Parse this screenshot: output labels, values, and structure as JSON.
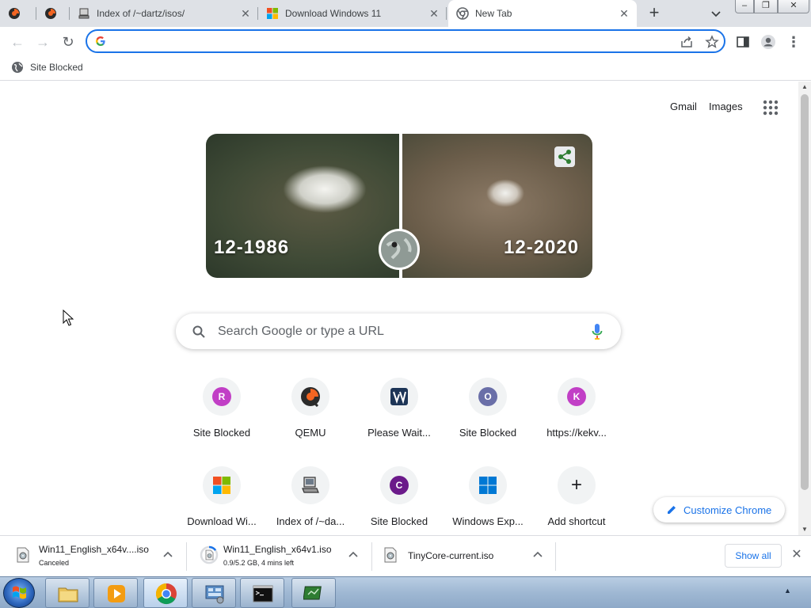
{
  "tabs": [
    {
      "title": "",
      "active": false
    },
    {
      "title": "",
      "active": false
    },
    {
      "title": "Index of /~dartz/isos/",
      "active": false
    },
    {
      "title": "Download Windows 11",
      "active": false
    },
    {
      "title": "New Tab",
      "active": true
    }
  ],
  "window_controls": {
    "minimize": "–",
    "restore": "❐",
    "close": "✕"
  },
  "toolbar": {
    "back_icon": "←",
    "forward_icon": "→",
    "reload_icon": "↻",
    "omnibox_value": "",
    "menu_icon": "⋮"
  },
  "bookmarks": [
    {
      "label": "Site Blocked"
    }
  ],
  "ntp": {
    "gmail": "Gmail",
    "images": "Images",
    "doodle": {
      "date_left": "12-1986",
      "date_right": "12-2020"
    },
    "search_placeholder": "Search Google or type a URL",
    "shortcuts": [
      {
        "label": "Site Blocked",
        "letter": "R",
        "color": "#c13fc6"
      },
      {
        "label": "QEMU",
        "letter": "",
        "color": "#f26522"
      },
      {
        "label": "Please Wait...",
        "letter": "",
        "color": "#1d4f91"
      },
      {
        "label": "Site Blocked",
        "letter": "O",
        "color": "#6a6fa8"
      },
      {
        "label": "https://kekv...",
        "letter": "K",
        "color": "#c13fc6"
      },
      {
        "label": "Download Wi...",
        "letter": "",
        "color": "#f25022"
      },
      {
        "label": "Index of /~da...",
        "letter": "",
        "color": "#555555"
      },
      {
        "label": "Site Blocked",
        "letter": "C",
        "color": "#6b1a8a"
      },
      {
        "label": "Windows Exp...",
        "letter": "",
        "color": "#0078d4"
      },
      {
        "label": "Add shortcut",
        "letter": "+",
        "color": "#202124"
      }
    ],
    "customize_label": "Customize Chrome"
  },
  "downloads": [
    {
      "name": "Win11_English_x64v....iso",
      "status": "Canceled"
    },
    {
      "name": "Win11_English_x64v1.iso",
      "status": "0.9/5.2 GB, 4 mins left"
    },
    {
      "name": "TinyCore-current.iso",
      "status": ""
    }
  ],
  "show_all_label": "Show all",
  "colors": {
    "accent": "#1a73e8",
    "tab_strip": "#dee1e6"
  },
  "taskbar": {
    "tray_arrow": "▲"
  }
}
